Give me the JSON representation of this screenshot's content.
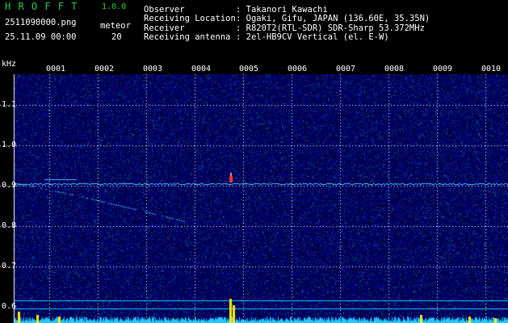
{
  "header": {
    "app_name": "H R O F F T",
    "version": "1.0.0",
    "filename": "2511090000.png",
    "datetime": "25.11.09 00:00",
    "meteor_label": "meteor",
    "meteor_count": "20",
    "rows": [
      {
        "label": "Observer",
        "value": ": Takanori Kawachi"
      },
      {
        "label": "Receiving Location",
        "value": ": Ogaki, Gifu, JAPAN (136.60E, 35.35N)"
      },
      {
        "label": "Receiver",
        "value": ": R820T2(RTL-SDR) SDR-Sharp 53.372MHz"
      },
      {
        "label": "Receiving antenna",
        "value": ": 2el-HB9CV Vertical (el. E-W)"
      }
    ]
  },
  "axis": {
    "unit": "kHz",
    "x_ticks": [
      "0001",
      "0002",
      "0003",
      "0004",
      "0005",
      "0006",
      "0007",
      "0008",
      "0009",
      "0010"
    ],
    "y_ticks": [
      "1.1",
      "1.0",
      "0.9",
      "0.8",
      "0.7",
      "0.6"
    ]
  },
  "colors": {
    "background": "#000000",
    "title_green": "#27d04a",
    "noise_blue": "#1818a0",
    "carrier": "#4fc3ff",
    "meteor_red": "#ff3030",
    "peak_yellow": "#ffee00",
    "baseline_cyan": "#20c8ff"
  }
}
